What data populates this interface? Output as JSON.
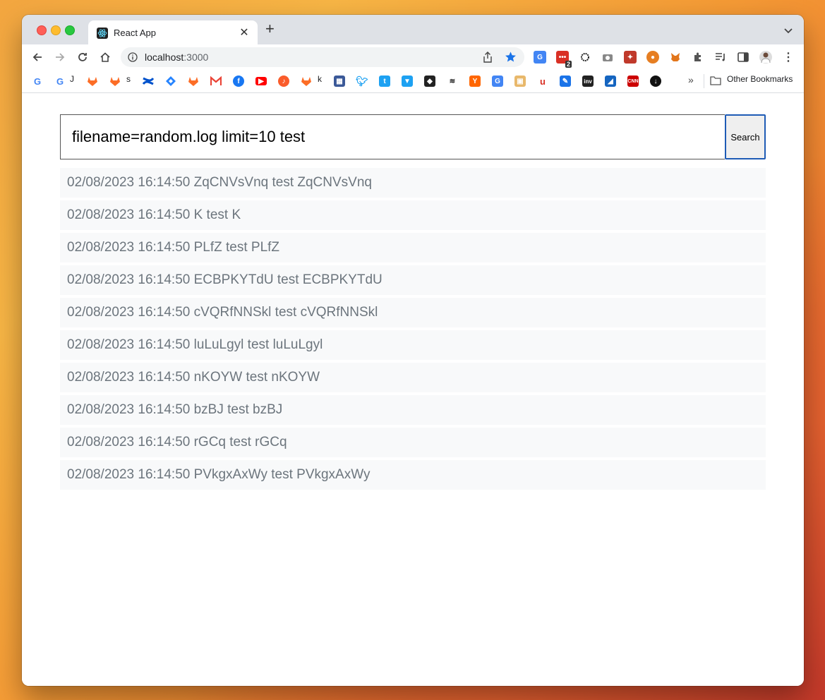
{
  "browser": {
    "tab_title": "React App",
    "url_host": "localhost",
    "url_port": ":3000",
    "extension_badge": "2",
    "bookmarks": [
      {
        "icon": "google-icon",
        "label": ""
      },
      {
        "icon": "google-icon",
        "label": "J"
      },
      {
        "icon": "gitlab-icon",
        "label": ""
      },
      {
        "icon": "gitlab-icon",
        "label": "s"
      },
      {
        "icon": "confluence-icon",
        "label": ""
      },
      {
        "icon": "jira-icon",
        "label": ""
      },
      {
        "icon": "gitlab-icon",
        "label": ""
      },
      {
        "icon": "gmail-icon",
        "label": ""
      },
      {
        "icon": "facebook-icon",
        "label": ""
      },
      {
        "icon": "youtube-icon",
        "label": ""
      },
      {
        "icon": "music-icon",
        "label": ""
      },
      {
        "icon": "gitlab-icon",
        "label": "k"
      }
    ],
    "other_bookmarks": "Other Bookmarks",
    "colors": {
      "tabstrip": "#dee1e6",
      "star": "#1a73e8",
      "button_border": "#1e5bb5",
      "row_bg": "#f8f9fa",
      "row_text": "#6c757d"
    }
  },
  "app": {
    "search_value": "filename=random.log limit=10 test",
    "search_button": "Search",
    "results": [
      "02/08/2023 16:14:50 ZqCNVsVnq test ZqCNVsVnq",
      "02/08/2023 16:14:50 K test K",
      "02/08/2023 16:14:50 PLfZ test PLfZ",
      "02/08/2023 16:14:50 ECBPKYTdU test ECBPKYTdU",
      "02/08/2023 16:14:50 cVQRfNNSkl test cVQRfNNSkl",
      "02/08/2023 16:14:50 luLuLgyl test luLuLgyl",
      "02/08/2023 16:14:50 nKOYW test nKOYW",
      "02/08/2023 16:14:50 bzBJ test bzBJ",
      "02/08/2023 16:14:50 rGCq test rGCq",
      "02/08/2023 16:14:50 PVkgxAxWy test PVkgxAxWy"
    ]
  }
}
